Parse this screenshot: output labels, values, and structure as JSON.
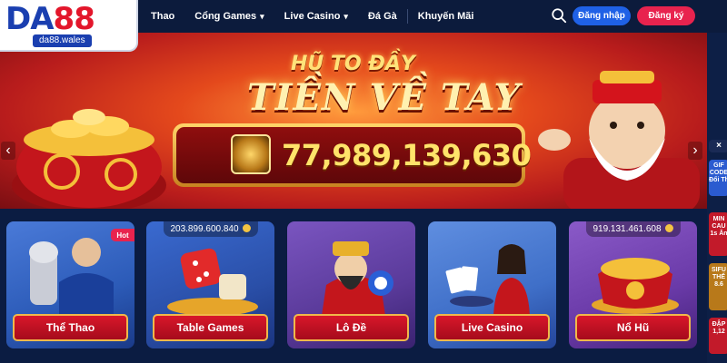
{
  "brand": {
    "logo_prefix": "DA",
    "logo_suffix": "88",
    "domain": "da88.wales"
  },
  "nav": {
    "items": [
      {
        "label": "Thao",
        "dropdown": false
      },
      {
        "label": "Cổng Games",
        "dropdown": true
      },
      {
        "label": "Live Casino",
        "dropdown": true
      },
      {
        "label": "Đá Gà",
        "dropdown": false
      },
      {
        "label": "Khuyến Mãi",
        "dropdown": false
      }
    ],
    "search_icon": "search-icon",
    "login_label": "Đăng nhập",
    "register_label": "Đăng ký"
  },
  "banner": {
    "title_line1": "HŨ TO ĐẦY",
    "title_line2": "TIỀN VỀ TAY",
    "jackpot_value": "77,989,139,630",
    "prev_icon": "chevron-left-icon",
    "next_icon": "chevron-right-icon"
  },
  "side_promos": {
    "items": [
      {
        "text": "×",
        "color": "#1a2a55"
      },
      {
        "text": "GIF CODE Đổi Th",
        "color": "#2b5bd0"
      },
      {
        "text": "MIN CAU 1s Ăn",
        "color": "#c21a2a"
      },
      {
        "text": "SIFU THẾ 8.6",
        "color": "#b8791a"
      },
      {
        "text": "ĐẬP 1,12",
        "color": "#c21a2a"
      }
    ]
  },
  "categories": [
    {
      "label": "Thể Thao",
      "amount": "",
      "hot": "Hot",
      "bg": "#2c5bb8"
    },
    {
      "label": "Table Games",
      "amount": "203.899.600.840",
      "hot": "",
      "bg": "#2a4fa8"
    },
    {
      "label": "Lô Đề",
      "amount": "",
      "hot": "",
      "bg": "#5a3a9a"
    },
    {
      "label": "Live Casino",
      "amount": "",
      "hot": "",
      "bg": "#3f6fc8"
    },
    {
      "label": "Nổ Hũ",
      "amount": "919.131.461.608",
      "hot": "",
      "bg": "#6a3aa8"
    }
  ],
  "colors": {
    "header_bg": "#0c1b3c",
    "login_button": "#1f61e6",
    "register_button": "#e8234e",
    "label_red": "#d8172a",
    "gold": "#ffe36a"
  }
}
